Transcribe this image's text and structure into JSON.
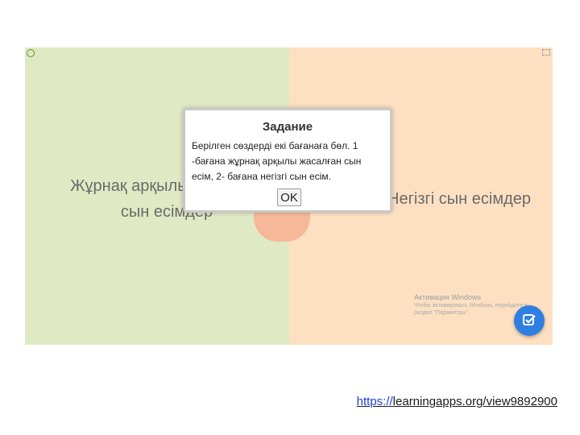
{
  "app": {
    "left_category": "Жұрнақ арқылы жасалған сын есімдер",
    "right_category": "Негізгі сын есімдер",
    "accent": "#2f7fe2"
  },
  "dialog": {
    "title": "Задание",
    "text": "Берілген сөздерді екі бағанаға бөл. 1 -бағана жұрнақ арқылы жасалған сын есім, 2- бағана негізгі сын есім.",
    "ok_label": "OK"
  },
  "watermark": {
    "title": "Активация Windows",
    "line": "Чтобы активировать Windows, перейдите в раздел \"Параметры\"."
  },
  "footer": {
    "url_protocol": "https://",
    "url_rest": "learningapps.org/view9892900"
  }
}
